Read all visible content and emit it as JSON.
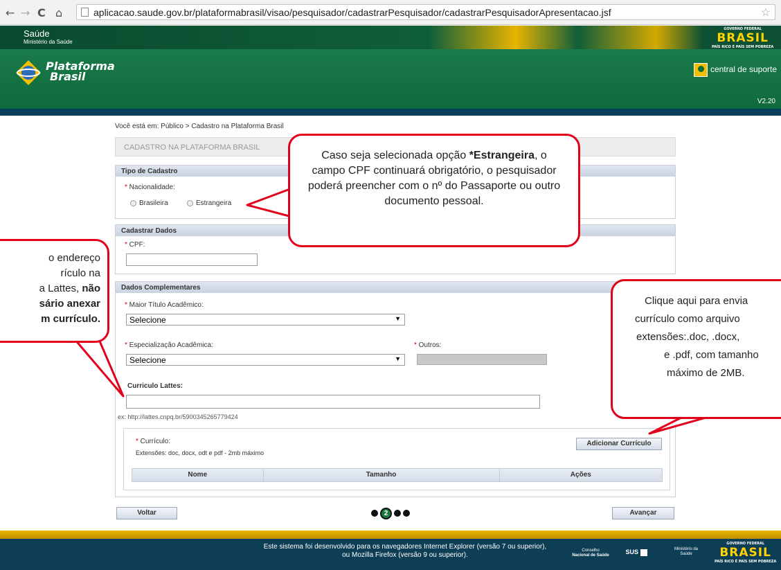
{
  "browser": {
    "back_icon": "arrow-left-icon",
    "forward_icon": "arrow-right-icon",
    "reload_icon": "reload-icon",
    "home_icon": "home-icon",
    "url": "aplicacao.saude.gov.br/plataformabrasil/visao/pesquisador/cadastrarPesquisador/cadastrarPesquisadorApresentacao.jsf"
  },
  "banner": {
    "saude": "Saúde",
    "ministerio": "Ministério da Saúde",
    "brasil_top": "GOVERNO FEDERAL",
    "brasil_main": "BRASIL",
    "brasil_sub": "PAÍS RICO É PAÍS SEM POBREZA"
  },
  "header": {
    "logo_line1": "Plataforma",
    "logo_line2": "Brasil",
    "support_label": "central de suporte",
    "version": "V2.20"
  },
  "breadcrumb": "Você está em: Público > Cadastro na Plataforma Brasil",
  "page_title": "CADASTRO NA PLATAFORMA BRASIL",
  "tipo_cadastro": {
    "header": "Tipo de Cadastro",
    "nacionalidade_label": "Nacionalidade:",
    "option_brasileira": "Brasileira",
    "option_estrangeira": "Estrangeira"
  },
  "cadastrar_dados": {
    "header": "Cadastrar Dados",
    "cpf_label": "CPF:",
    "cpf_value": ""
  },
  "dados_complementares": {
    "header": "Dados Complementares",
    "titulo_label": "Maior Título Acadêmico:",
    "titulo_value": "Selecione",
    "especializacao_label": "Especialização Acadêmica:",
    "especializacao_value": "Selecione",
    "outros_label": "Outros:",
    "lattes_label": "Curriculo Lattes:",
    "lattes_value": "",
    "lattes_example": "ex: http://lattes.cnpq.br/5900345265779424",
    "curriculo_label": "Currículo:",
    "curriculo_extensoes": "Extensões: doc, docx, odt e pdf - 2mb máximo",
    "add_button": "Adicionar Currículo",
    "table_columns": [
      "Nome",
      "Tamanho",
      "Ações"
    ]
  },
  "nav": {
    "back_button": "Voltar",
    "next_button": "Avançar",
    "current_step": "2"
  },
  "footer": {
    "text_line1": "Este sistema foi desenvolvido para os navegadores Internet Explorer (versão 7 ou superior),",
    "text_line2": "ou Mozilla Firefox (versão 9 ou superior).",
    "conselho_line1": "Conselho",
    "conselho_line2": "Nacional de Saúde",
    "sus": "SUS",
    "ministerio_line1": "Ministério da",
    "ministerio_line2": "Saúde"
  },
  "callouts": {
    "estrangeira_pre": "Caso seja selecionada opção ",
    "estrangeira_bold": "*Estrangeira",
    "estrangeira_post": ", o campo CPF continuará obrigatório, o pesquisador poderá preencher com o nº do Passaporte ou outro documento pessoal.",
    "lattes_line1": "o endereço",
    "lattes_line2": "rículo na",
    "lattes_line3_pre": "a Lattes, ",
    "lattes_line3_bold": "não",
    "lattes_line4": "sário anexar",
    "lattes_line5": "m currículo.",
    "arquivo_line1": "Clique aqui para envia",
    "arquivo_line2": "currículo como arquivo",
    "arquivo_line3": "extensões:.doc, .docx,",
    "arquivo_line4": "e .pdf, com tamanho",
    "arquivo_line5": "máximo de 2MB."
  }
}
